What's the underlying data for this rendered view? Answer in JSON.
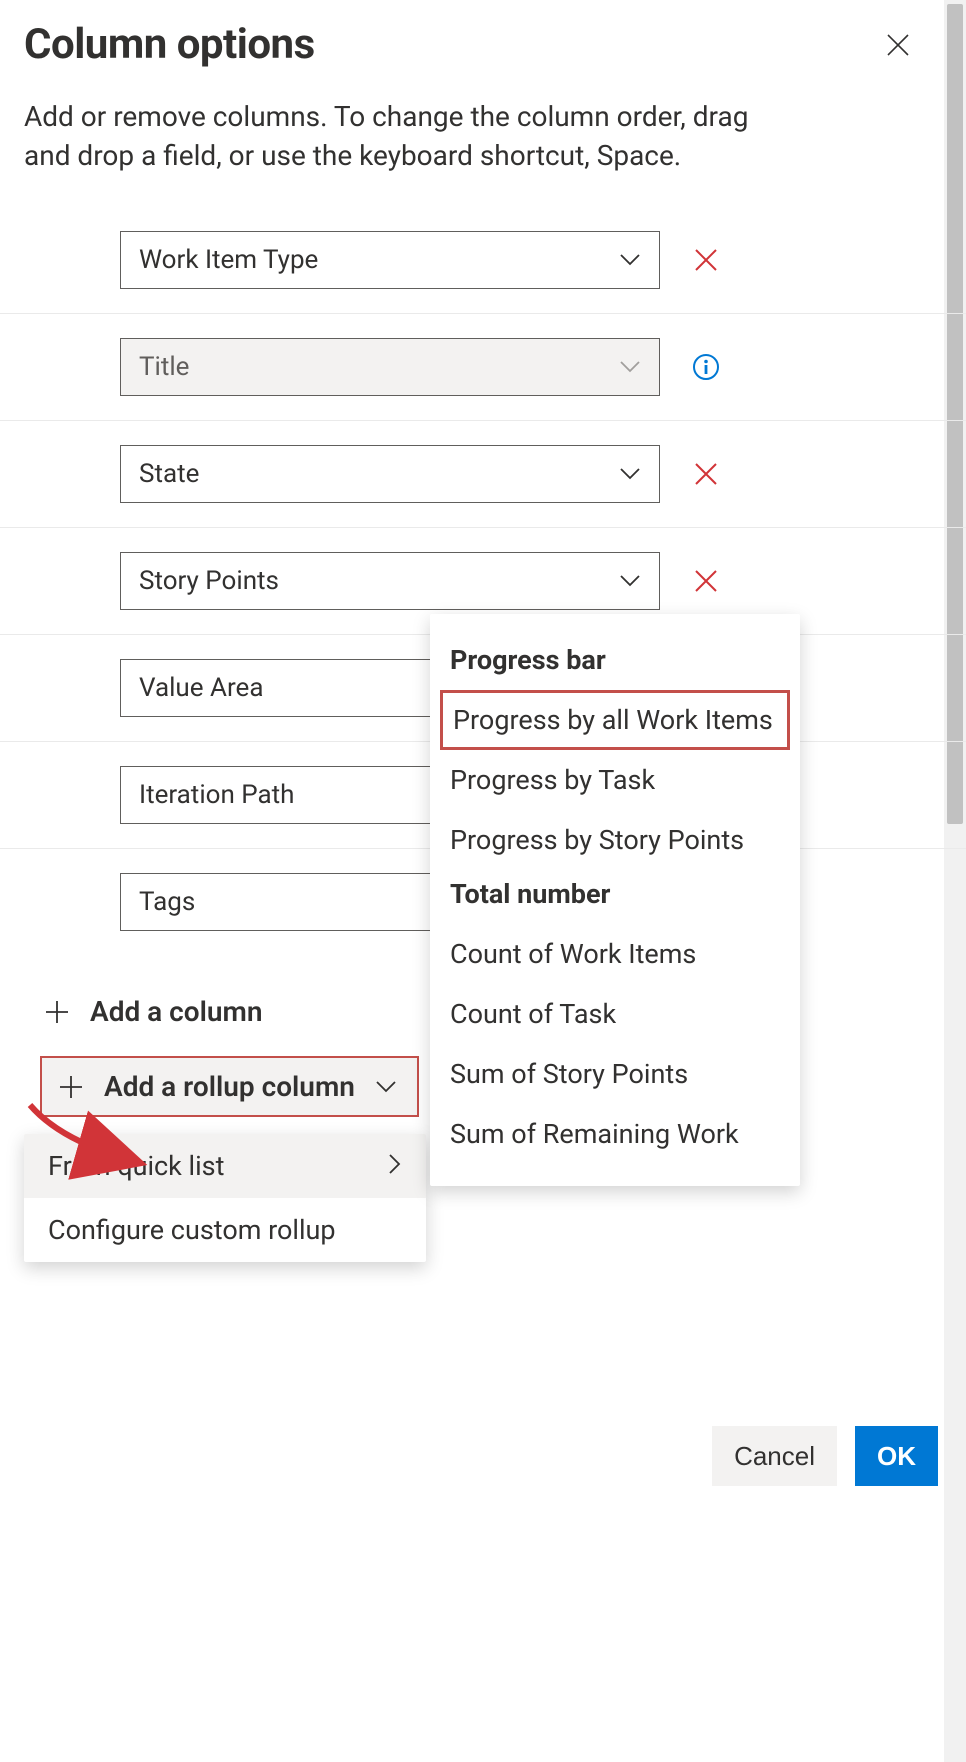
{
  "title": "Column options",
  "description": "Add or remove columns. To change the column order, drag and drop a field, or use the keyboard shortcut, Space.",
  "columns": [
    {
      "label": "Work Item Type",
      "action": "remove",
      "disabled": false
    },
    {
      "label": "Title",
      "action": "info",
      "disabled": true
    },
    {
      "label": "State",
      "action": "remove",
      "disabled": false
    },
    {
      "label": "Story Points",
      "action": "remove",
      "disabled": false
    },
    {
      "label": "Value Area",
      "action": "remove",
      "disabled": false
    },
    {
      "label": "Iteration Path",
      "action": "remove",
      "disabled": false
    },
    {
      "label": "Tags",
      "action": "remove",
      "disabled": false
    }
  ],
  "addLinks": {
    "addColumn": "Add a column",
    "addRollup": "Add a rollup column"
  },
  "rollupMenu": {
    "fromQuickList": "From quick list",
    "configureCustom": "Configure custom rollup"
  },
  "quickList": {
    "progressHeader": "Progress bar",
    "progressItems": [
      "Progress by all Work Items",
      "Progress by Task",
      "Progress by Story Points"
    ],
    "totalHeader": "Total number",
    "totalItems": [
      "Count of Work Items",
      "Count of Task",
      "Sum of Story Points",
      "Sum of Remaining Work"
    ]
  },
  "footer": {
    "cancel": "Cancel",
    "ok": "OK"
  }
}
